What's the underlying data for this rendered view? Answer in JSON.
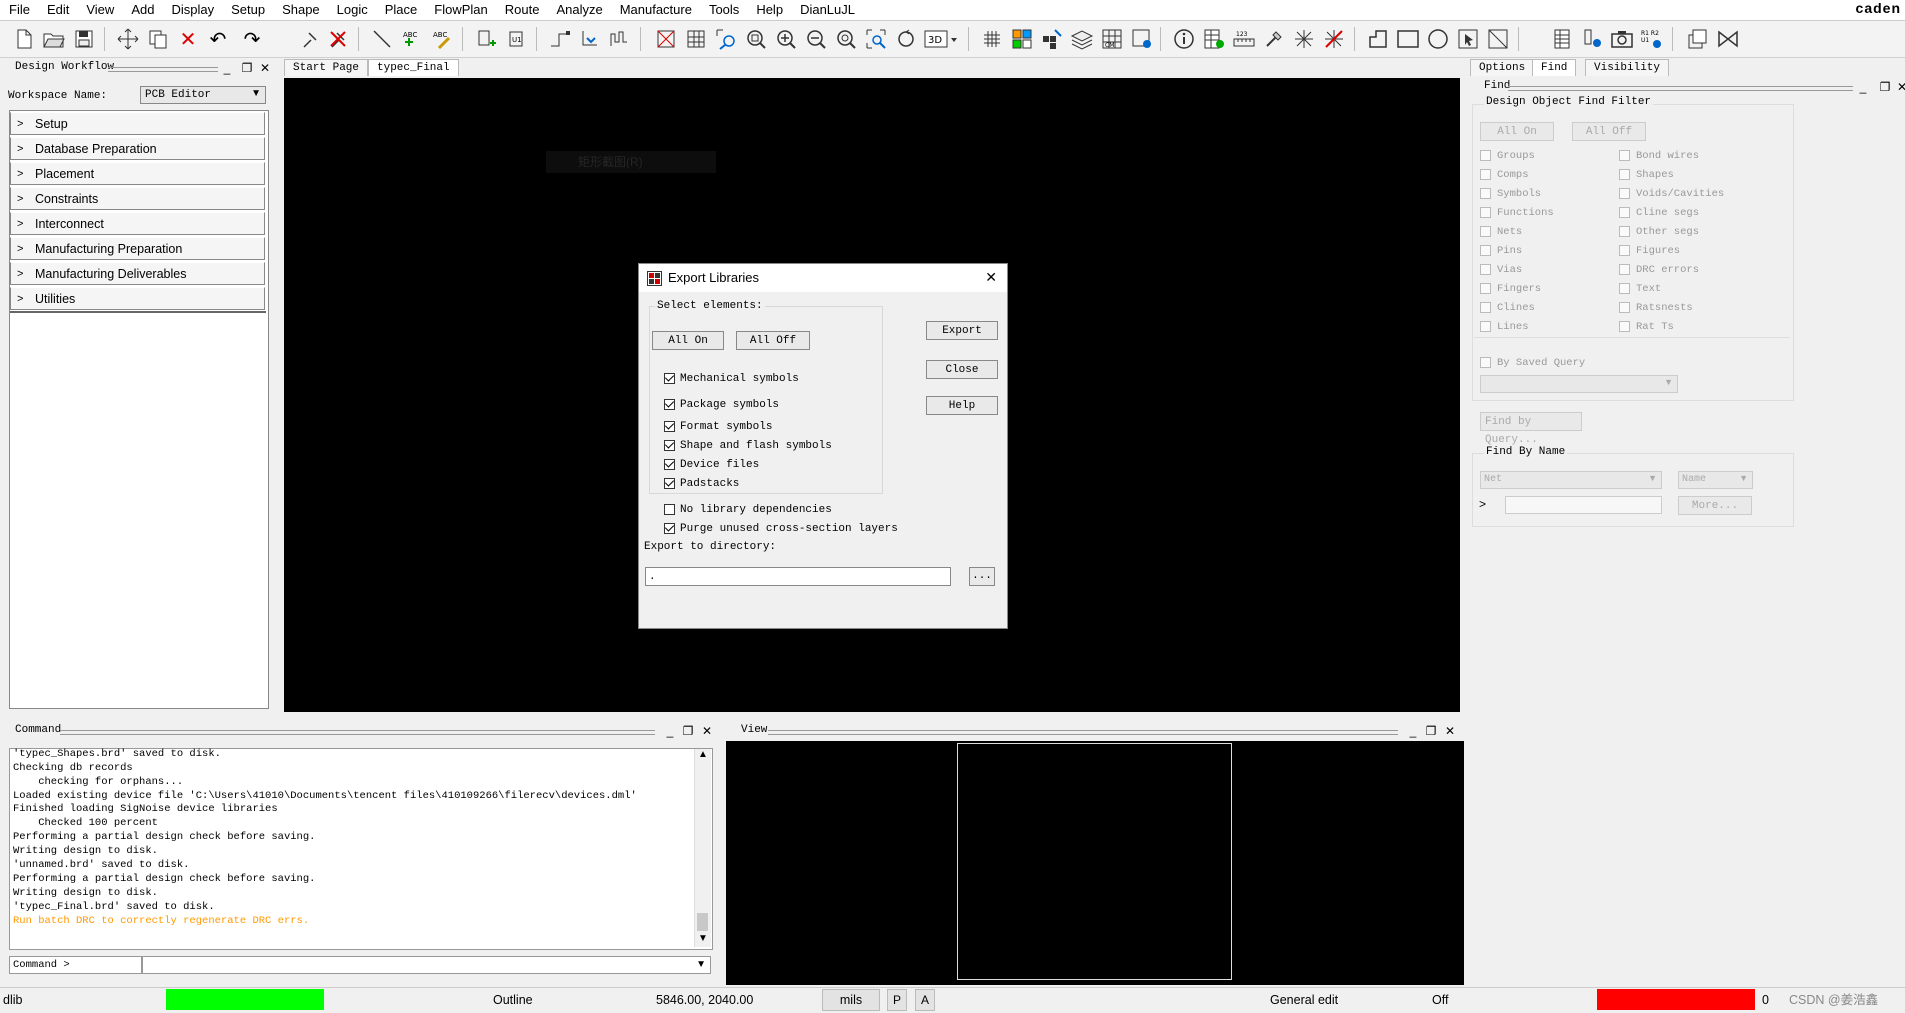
{
  "menu": [
    "File",
    "Edit",
    "View",
    "Add",
    "Display",
    "Setup",
    "Shape",
    "Logic",
    "Place",
    "FlowPlan",
    "Route",
    "Analyze",
    "Manufacture",
    "Tools",
    "Help",
    "DianLuJL"
  ],
  "brand": "caden",
  "workflow": {
    "title": "Design Workflow",
    "workspace_label": "Workspace Name:",
    "workspace_value": "PCB Editor",
    "items": [
      "Setup",
      "Database Preparation",
      "Placement",
      "Constraints",
      "Interconnect",
      "Manufacturing Preparation",
      "Manufacturing Deliverables",
      "Utilities"
    ]
  },
  "tabs": [
    "Start Page",
    "typec_Final"
  ],
  "canvas_ghost_text": "矩形截图(R)",
  "dialog": {
    "title": "Export Libraries",
    "close_glyph": "✕",
    "group_label": "Select elements:",
    "all_on": "All On",
    "all_off": "All Off",
    "elements": [
      {
        "label": "Mechanical symbols",
        "checked": true
      },
      {
        "label": "Package symbols",
        "checked": true
      },
      {
        "label": "Format symbols",
        "checked": true
      },
      {
        "label": "Shape and flash symbols",
        "checked": true
      },
      {
        "label": "Device files",
        "checked": true
      },
      {
        "label": "Padstacks",
        "checked": true
      }
    ],
    "no_lib_deps": {
      "label": "No library dependencies",
      "checked": false
    },
    "purge_layers": {
      "label": "Purge unused cross-section layers",
      "checked": true
    },
    "export_dir_label": "Export to directory:",
    "export_dir_value": ".",
    "browse": "...",
    "export_btn": "Export",
    "close_btn": "Close",
    "help_btn": "Help"
  },
  "right_tabs": [
    "Options",
    "Find",
    "Visibility"
  ],
  "find": {
    "title": "Find",
    "filter_title": "Design Object Find Filter",
    "all_on": "All On",
    "all_off": "All Off",
    "left_col": [
      "Groups",
      "Comps",
      "Symbols",
      "Functions",
      "Nets",
      "Pins",
      "Vias",
      "Fingers",
      "Clines",
      "Lines"
    ],
    "right_col": [
      "Bond wires",
      "Shapes",
      "Voids/Cavities",
      "Cline segs",
      "Other segs",
      "Figures",
      "DRC errors",
      "Text",
      "Ratsnests",
      "Rat Ts"
    ],
    "saved_query": "By Saved Query",
    "find_by_query": "Find by Query...",
    "find_by_name": "Find By Name",
    "type_value": "Net",
    "name_value": "Name",
    "more": "More..."
  },
  "command": {
    "title": "Command",
    "lines": [
      "'typec_Shapes.brd' saved to disk.",
      "Checking db records",
      "    checking for orphans...",
      "Loaded existing device file 'C:\\Users\\41010\\Documents\\tencent files\\410109266\\filerecv\\devices.dml'",
      "Finished loading SigNoise device libraries",
      "    Checked 100 percent",
      "Performing a partial design check before saving.",
      "Writing design to disk.",
      "'unnamed.brd' saved to disk.",
      "Performing a partial design check before saving.",
      "Writing design to disk.",
      "'typec_Final.brd' saved to disk."
    ],
    "warning": "Run batch DRC to correctly regenerate DRC errs.",
    "prompt": "Command >"
  },
  "view": {
    "title": "View"
  },
  "status": {
    "app": "dlib",
    "mode": "Outline",
    "coords": "5846.00, 2040.00",
    "units": "mils",
    "p": "P",
    "a": "A",
    "edit_mode": "General edit",
    "off": "Off",
    "count": "0",
    "watermark": "CSDN @姜浩鑫"
  },
  "colors": {
    "ready": "#00ff00",
    "drc": "#ff0000",
    "canvas": "#000000",
    "warning": "#ff9900"
  }
}
